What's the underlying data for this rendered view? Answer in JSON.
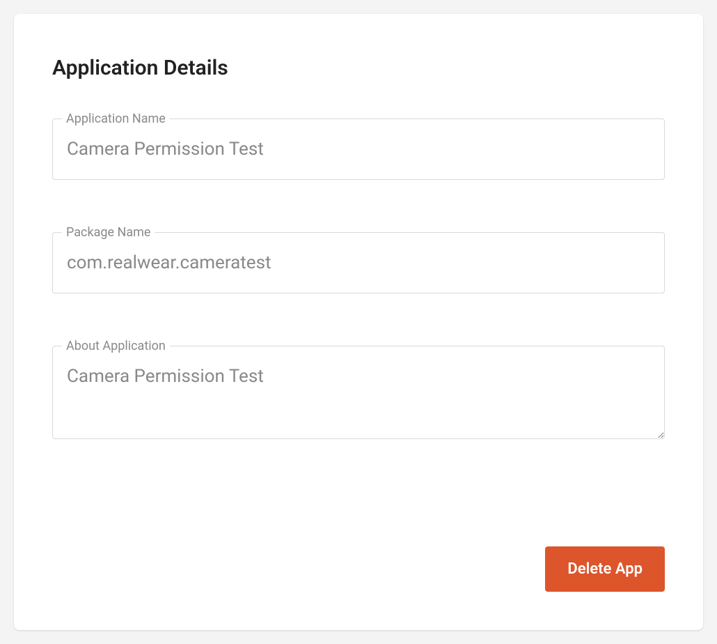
{
  "page": {
    "title": "Application Details"
  },
  "fields": {
    "appName": {
      "label": "Application Name",
      "value": "Camera Permission Test"
    },
    "packageName": {
      "label": "Package Name",
      "value": "com.realwear.cameratest"
    },
    "about": {
      "label": "About Application",
      "value": "Camera Permission Test"
    }
  },
  "actions": {
    "deleteLabel": "Delete App"
  }
}
